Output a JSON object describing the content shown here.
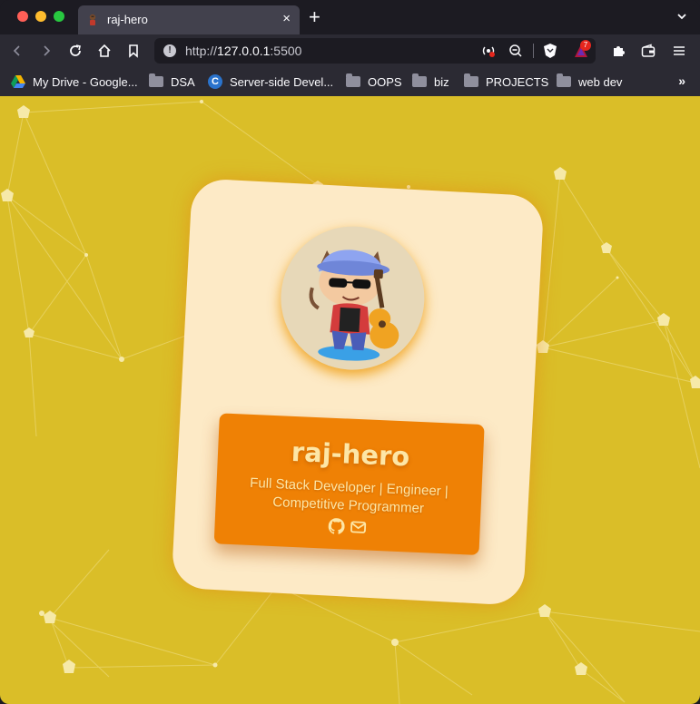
{
  "browser": {
    "tab": {
      "title": "raj-hero",
      "close_icon": "×"
    },
    "new_tab_icon": "+",
    "url": {
      "scheme": "http://",
      "host": "127.0.0.1",
      "port": ":5500"
    },
    "extension_badge_count": "7"
  },
  "bookmarks": [
    {
      "label": "My Drive - Google...",
      "icon": "google-drive-icon"
    },
    {
      "label": "DSA",
      "icon": "folder-icon"
    },
    {
      "label": "Server-side Devel...",
      "icon": "coursera-icon"
    },
    {
      "label": "OOPS",
      "icon": "folder-icon"
    },
    {
      "label": "biz",
      "icon": "folder-icon"
    },
    {
      "label": "PROJECTS",
      "icon": "folder-icon"
    },
    {
      "label": "web dev",
      "icon": "folder-icon"
    }
  ],
  "bookmarks_more": "»",
  "profile": {
    "name": "raj-hero",
    "role": "Full Stack Developer | Engineer | Competitive Programmer",
    "socials": [
      "github-icon",
      "mail-icon"
    ]
  },
  "colors": {
    "page_bg": "#dabe28",
    "card_bg": "#fdeac6",
    "info_bg": "#ef8105",
    "text_accent": "#fde6a6"
  }
}
